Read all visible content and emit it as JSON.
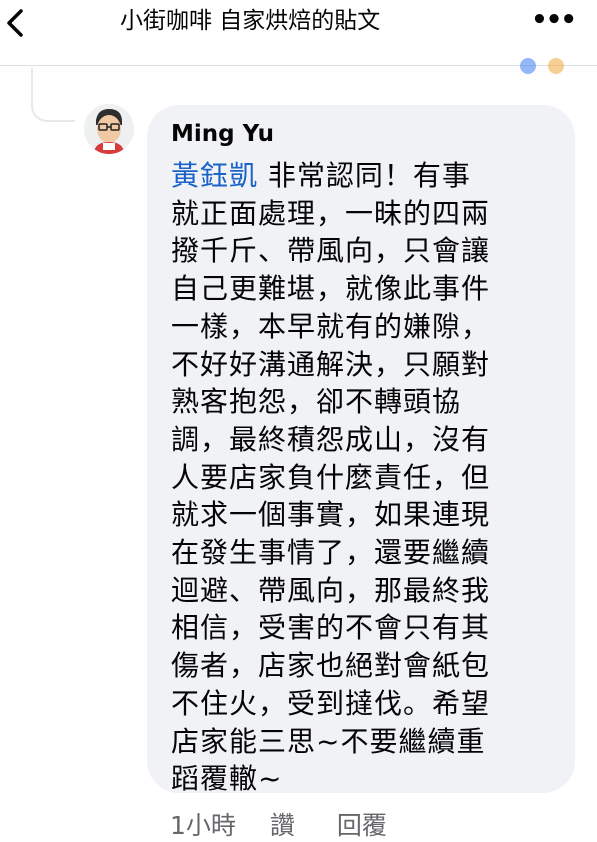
{
  "header": {
    "title": "小街咖啡 自家烘焙的貼文",
    "more_label": "•••"
  },
  "comment": {
    "author": "Ming Yu",
    "mention": "黃鈺凱",
    "lines": [
      " 非常認同！有事",
      "就正面處理，一昧的四兩",
      "撥千斤、帶風向，只會讓",
      "自己更難堪，就像此事件",
      "一樣，本早就有的嫌隙，",
      "不好好溝通解決，只願對",
      "熟客抱怨，卻不轉頭協",
      "調，最終積怨成山，沒有",
      "人要店家負什麼責任，但",
      "就求一個事實，如果連現",
      "在發生事情了，還要繼續",
      "迴避、帶風向，那最終我",
      "相信，受害的不會只有其",
      "傷者，店家也絕對會紙包",
      "不住火，受到撻伐。希望",
      "店家能三思~不要繼續重",
      "蹈覆轍~"
    ],
    "time": "1小時",
    "like_label": "讚",
    "reply_label": "回覆"
  },
  "colors": {
    "mention": "#1b63c9",
    "bubble": "#f0f2f5",
    "meta": "#65676b"
  }
}
